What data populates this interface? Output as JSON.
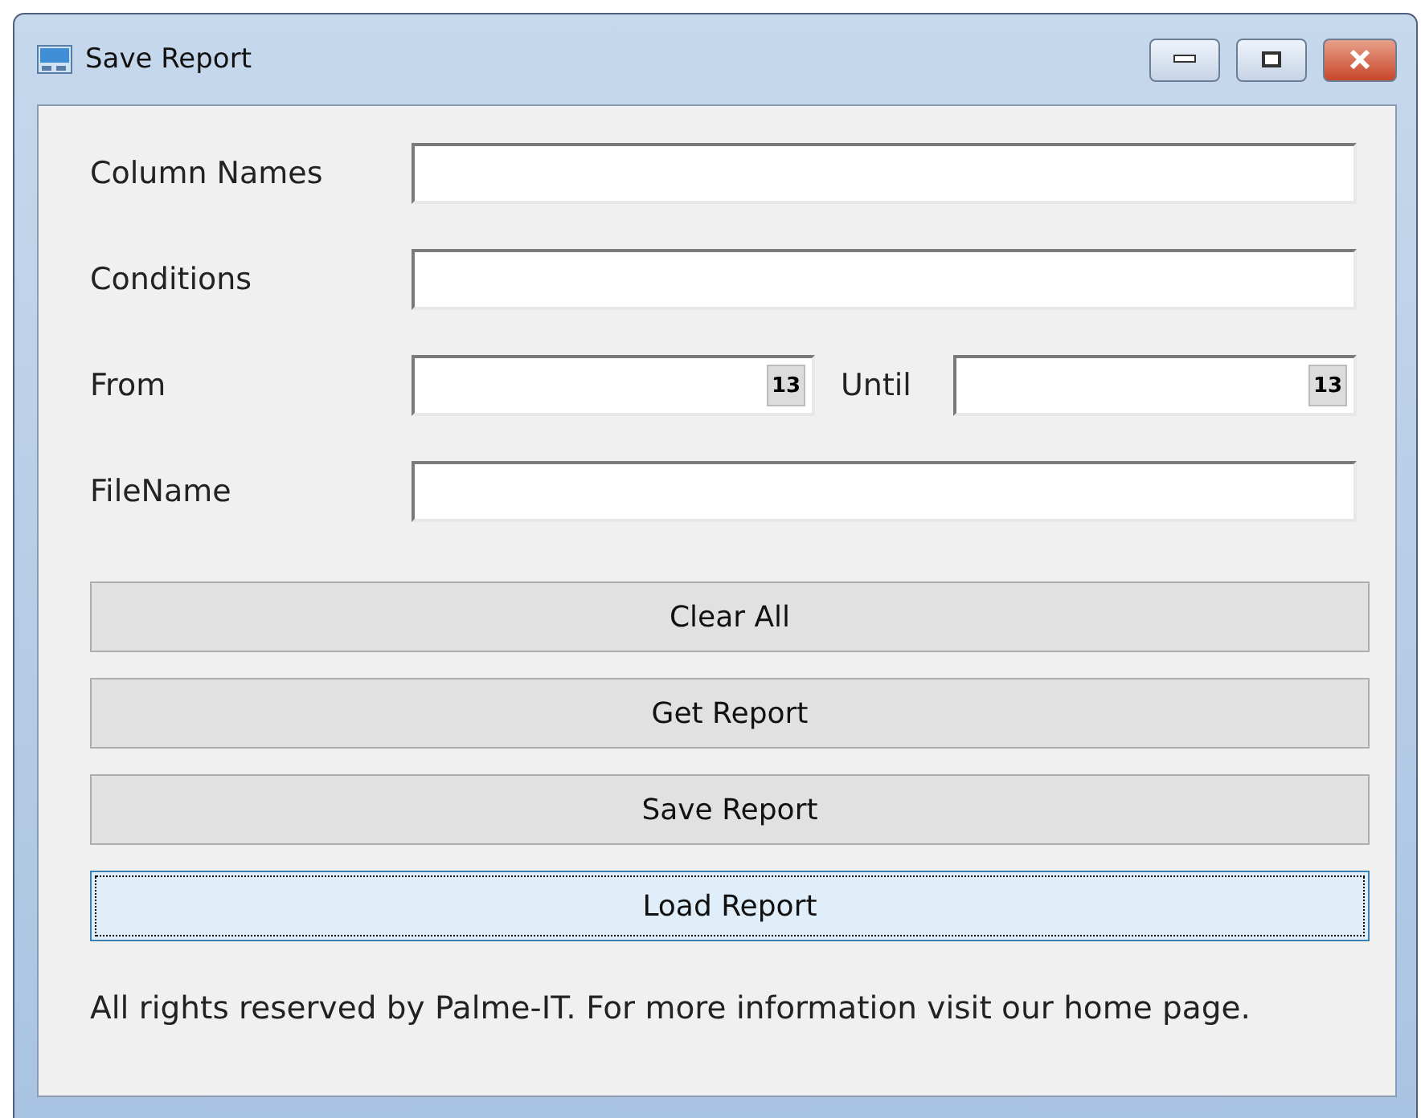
{
  "window": {
    "title": "Save Report"
  },
  "fields": [
    {
      "kind": "text",
      "label": "Column Names"
    },
    {
      "kind": "text",
      "label": "Conditions"
    },
    {
      "kind": "dates",
      "label": "From",
      "calendar_day": "13",
      "second_label": "Until",
      "second_calendar_day": "13"
    },
    {
      "kind": "text",
      "label": "FileName"
    }
  ],
  "buttons": [
    {
      "label": "Clear All",
      "focused": false
    },
    {
      "label": "Get Report",
      "focused": false
    },
    {
      "label": "Save Report",
      "focused": false
    },
    {
      "label": "Load Report",
      "focused": true
    }
  ],
  "footer": "All rights reserved by Palme-IT. For more information visit our home page."
}
